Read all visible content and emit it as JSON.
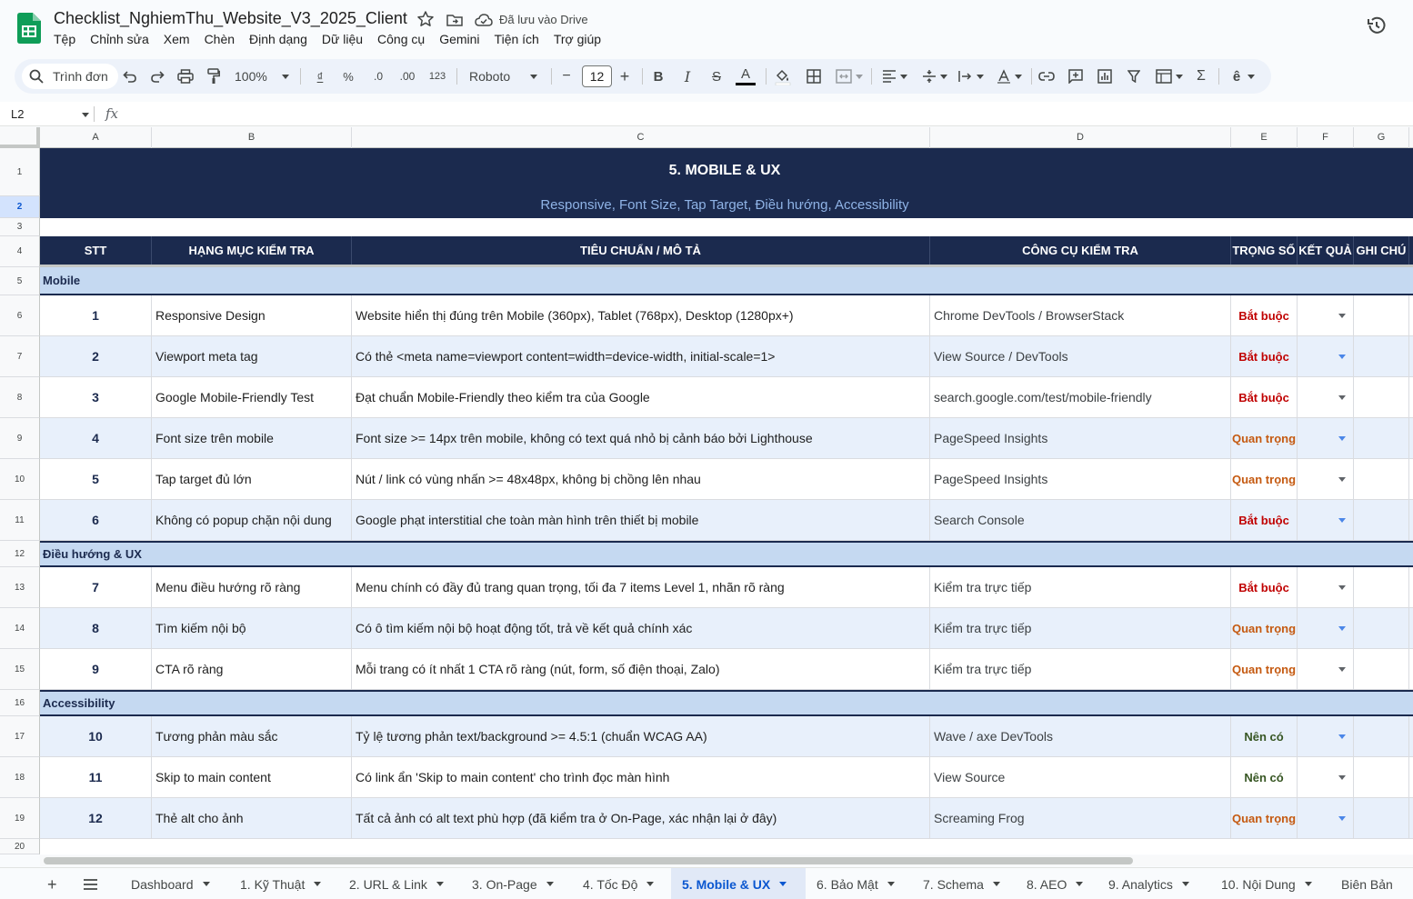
{
  "app": {
    "doc_title": "Checklist_NghiemThu_Website_V3_2025_Client",
    "save_status": "Đã lưu vào Drive",
    "menu": [
      "Tệp",
      "Chỉnh sửa",
      "Xem",
      "Chèn",
      "Định dạng",
      "Dữ liệu",
      "Công cụ",
      "Gemini",
      "Tiện ích",
      "Trợ giúp"
    ]
  },
  "toolbar": {
    "search_menus": "Trình đơn",
    "zoom": "100%",
    "currency": "₫",
    "percent": "%",
    "dec_decrease": ".0",
    "dec_increase": ".00",
    "number_format": "123",
    "font": "Roboto",
    "font_size": "12",
    "minus": "−",
    "plus": "+"
  },
  "formula_bar": {
    "name_box": "L2",
    "fx": "fx"
  },
  "grid": {
    "columns": [
      "A",
      "B",
      "C",
      "D",
      "E",
      "F",
      "G"
    ],
    "selected_row": 2,
    "title": "5. MOBILE & UX",
    "subtitle": "Responsive, Font Size, Tap Target, Điều hướng, Accessibility",
    "headers": [
      "STT",
      "HẠNG MỤC KIỂM TRA",
      "TIÊU CHUẨN / MÔ TẢ",
      "CÔNG CỤ KIỂM TRA",
      "TRỌNG SỐ",
      "KẾT QUẢ",
      "GHI CHÚ"
    ],
    "sections": [
      {
        "name": "Mobile"
      },
      {
        "name": "Điều hướng & UX"
      },
      {
        "name": "Accessibility"
      }
    ],
    "items": [
      {
        "stt": "1",
        "item": "Responsive Design",
        "desc": "Website hiển thị đúng trên Mobile (360px), Tablet (768px), Desktop (1280px+)",
        "tool": "Chrome DevTools / BrowserStack",
        "weight": "Bắt buộc"
      },
      {
        "stt": "2",
        "item": "Viewport meta tag",
        "desc": "Có thẻ <meta name=viewport content=width=device-width, initial-scale=1>",
        "tool": "View Source / DevTools",
        "weight": "Bắt buộc"
      },
      {
        "stt": "3",
        "item": "Google Mobile-Friendly Test",
        "desc": "Đạt chuẩn Mobile-Friendly theo kiểm tra của Google",
        "tool": "search.google.com/test/mobile-friendly",
        "weight": "Bắt buộc"
      },
      {
        "stt": "4",
        "item": "Font size trên mobile",
        "desc": "Font size >= 14px trên mobile, không có text quá nhỏ bị cảnh báo bởi Lighthouse",
        "tool": "PageSpeed Insights",
        "weight": "Quan trọng"
      },
      {
        "stt": "5",
        "item": "Tap target đủ lớn",
        "desc": "Nút / link có vùng nhấn >= 48x48px, không bị chồng lên nhau",
        "tool": "PageSpeed Insights",
        "weight": "Quan trọng"
      },
      {
        "stt": "6",
        "item": "Không có popup chặn nội dung",
        "desc": "Google phạt interstitial che toàn màn hình trên thiết bị mobile",
        "tool": "Search Console",
        "weight": "Bắt buộc"
      },
      {
        "stt": "7",
        "item": "Menu điều hướng rõ ràng",
        "desc": "Menu chính có đầy đủ trang quan trọng, tối đa 7 items Level 1, nhãn rõ ràng",
        "tool": "Kiểm tra trực tiếp",
        "weight": "Bắt buộc"
      },
      {
        "stt": "8",
        "item": "Tìm kiếm nội bộ",
        "desc": "Có ô tìm kiếm nội bộ hoạt động tốt, trả về kết quả chính xác",
        "tool": "Kiểm tra trực tiếp",
        "weight": "Quan trọng"
      },
      {
        "stt": "9",
        "item": "CTA rõ ràng",
        "desc": "Mỗi trang có ít nhất 1 CTA rõ ràng (nút, form, số điện thoại, Zalo)",
        "tool": "Kiểm tra trực tiếp",
        "weight": "Quan trọng"
      },
      {
        "stt": "10",
        "item": "Tương phản màu sắc",
        "desc": "Tỷ lệ tương phản text/background >= 4.5:1 (chuẩn WCAG AA)",
        "tool": "Wave / axe DevTools",
        "weight": "Nên có"
      },
      {
        "stt": "11",
        "item": "Skip to main content",
        "desc": "Có link ẩn 'Skip to main content' cho trình đọc màn hình",
        "tool": "View Source",
        "weight": "Nên có"
      },
      {
        "stt": "12",
        "item": "Thẻ alt cho ảnh",
        "desc": "Tất cả ảnh có alt text phù hợp (đã kiểm tra ở On-Page, xác nhận lại ở đây)",
        "tool": "Screaming Frog",
        "weight": "Quan trọng"
      }
    ]
  },
  "sheets": {
    "tabs": [
      "Dashboard",
      "1. Kỹ Thuật",
      "2. URL & Link",
      "3. On-Page",
      "4. Tốc Độ",
      "5. Mobile & UX",
      "6. Bảo Mật",
      "7. Schema",
      "8. AEO",
      "9. Analytics",
      "10. Nội Dung",
      "Biên Bản"
    ],
    "active": "5. Mobile & UX"
  },
  "colors": {
    "header_navy": "#1b2a4e",
    "section_blue": "#c5d9f1",
    "alt_row": "#e8f0fb",
    "required": "#c00000",
    "important": "#c55a11",
    "optional": "#375623",
    "active_tab": "#0b57d0"
  }
}
